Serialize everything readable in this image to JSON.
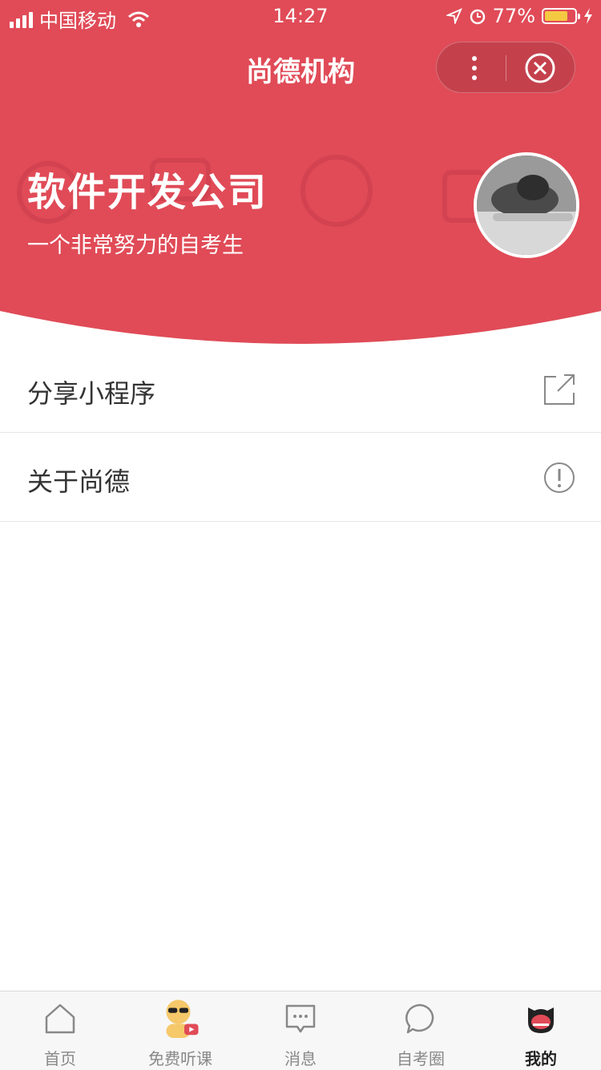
{
  "status_bar": {
    "carrier": "中国移动",
    "time": "14:27",
    "battery": "77%",
    "battery_level": 0.77
  },
  "nav": {
    "title": "尚德机构"
  },
  "profile": {
    "company": "软件开发公司",
    "slogan": "一个非常努力的自考生"
  },
  "menu": [
    {
      "label": "分享小程序",
      "icon": "share-icon"
    },
    {
      "label": "关于尚德",
      "icon": "info-icon"
    }
  ],
  "tabs": [
    {
      "label": "首页",
      "icon": "home-icon"
    },
    {
      "label": "免费听课",
      "icon": "free-course-icon"
    },
    {
      "label": "消息",
      "icon": "message-icon"
    },
    {
      "label": "自考圈",
      "icon": "circle-chat-icon"
    },
    {
      "label": "我的",
      "icon": "mine-icon",
      "active": true
    }
  ],
  "colors": {
    "brand": "#e04b57",
    "tab_active": "#222222",
    "tab_inactive": "#888888"
  }
}
